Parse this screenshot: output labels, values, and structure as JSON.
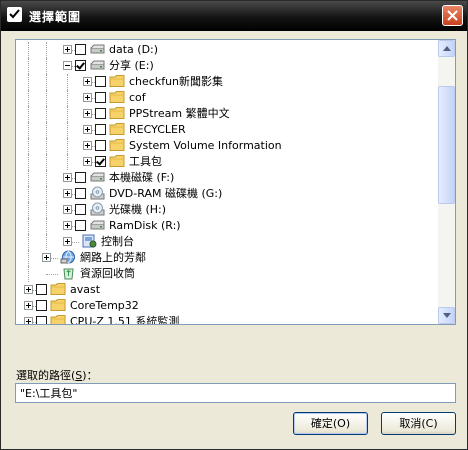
{
  "window": {
    "title": "選擇範圍"
  },
  "tree": {
    "rows": [
      {
        "label": "data (D:)",
        "icon": "drive-icon",
        "expander": "plus",
        "checked": false
      },
      {
        "label": "分享 (E:)",
        "icon": "drive-icon",
        "expander": "minus",
        "checked": true
      },
      {
        "label": "checkfun新聞影集",
        "icon": "folder-icon",
        "expander": "plus",
        "checked": false
      },
      {
        "label": "cof",
        "icon": "folder-icon",
        "expander": "plus",
        "checked": false
      },
      {
        "label": "PPStream 繁體中文",
        "icon": "folder-icon",
        "expander": "plus",
        "checked": false
      },
      {
        "label": "RECYCLER",
        "icon": "folder-icon",
        "expander": "plus",
        "checked": false
      },
      {
        "label": "System Volume Information",
        "icon": "folder-icon",
        "expander": "plus",
        "checked": false
      },
      {
        "label": "工具包",
        "icon": "folder-icon",
        "expander": "plus",
        "checked": true
      },
      {
        "label": "本機磁碟 (F:)",
        "icon": "drive-icon",
        "expander": "plus",
        "checked": false
      },
      {
        "label": "DVD-RAM 磁碟機 (G:)",
        "icon": "cdrom-icon",
        "expander": "plus",
        "checked": false
      },
      {
        "label": "光碟機 (H:)",
        "icon": "cdrom-icon",
        "expander": "plus",
        "checked": false
      },
      {
        "label": "RamDisk (R:)",
        "icon": "drive-icon",
        "expander": "plus",
        "checked": false
      },
      {
        "label": "控制台",
        "icon": "control-panel-icon",
        "expander": "plus",
        "checked": null
      },
      {
        "label": "網路上的芳鄰",
        "icon": "network-places-icon",
        "expander": "plus",
        "checked": null
      },
      {
        "label": "資源回收筒",
        "icon": "recycle-bin-icon",
        "expander": null,
        "checked": null
      },
      {
        "label": "avast",
        "icon": "folder-icon",
        "expander": "plus",
        "checked": false
      },
      {
        "label": "CoreTemp32",
        "icon": "folder-icon",
        "expander": "plus",
        "checked": false
      },
      {
        "label": "CPU-Z 1.51 系統監測",
        "icon": "folder-icon",
        "expander": "plus",
        "checked": false
      }
    ],
    "scroll_position": 0.2
  },
  "path": {
    "label": "選取的路徑",
    "accel": "S",
    "label_suffix": "：",
    "value": "\"E:\\工具包\""
  },
  "buttons": {
    "ok": "確定(O)",
    "cancel": "取消(C)"
  },
  "colors": {
    "title_bar": "#000000",
    "dialog_bg": "#ece9d8",
    "close_button": "#d5512b",
    "folder": "#f6d36a"
  }
}
